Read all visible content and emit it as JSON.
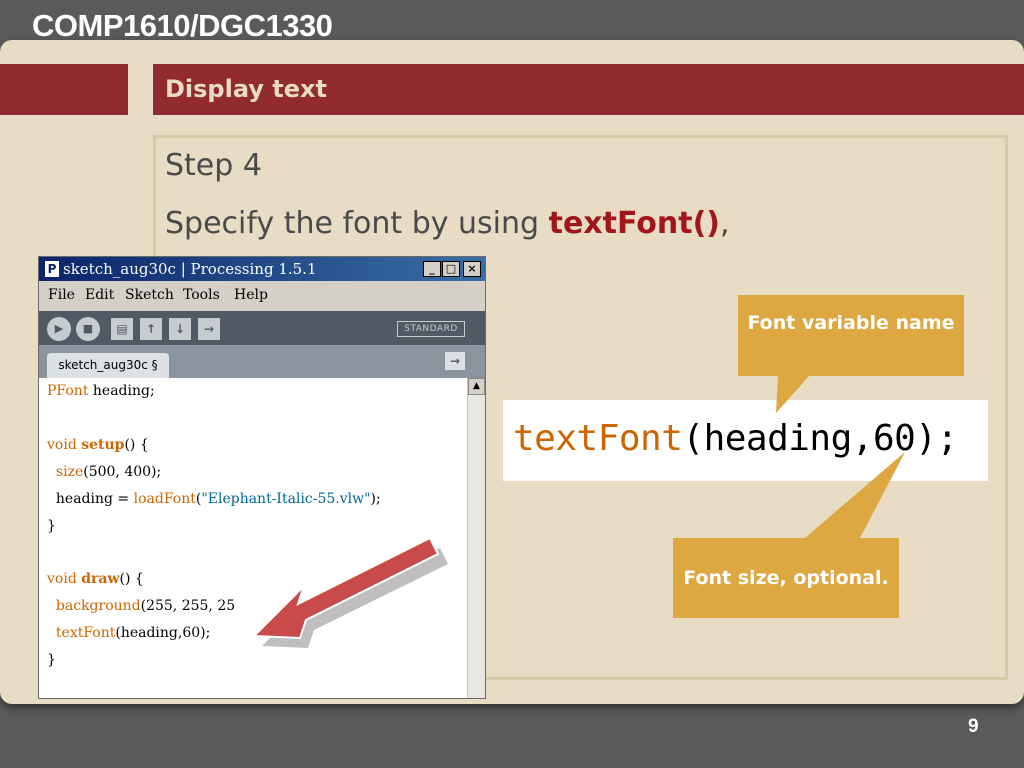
{
  "header": {
    "course": "COMP1610/DGC1330",
    "title": "Display text"
  },
  "content": {
    "step": "Step 4",
    "description_prefix": "Specify the font by using ",
    "description_keyword": "textFont()",
    "description_suffix": ","
  },
  "window": {
    "icon": "P",
    "title": "sketch_aug30c | Processing 1.5.1",
    "controls": {
      "minimize": "_",
      "maximize": "□",
      "close": "×"
    },
    "menu": [
      "File",
      "Edit",
      "Sketch",
      "Tools",
      "Help"
    ],
    "toolbar": {
      "icons": [
        "run-icon",
        "stop-icon",
        "new-icon",
        "open-icon",
        "save-icon",
        "export-icon"
      ],
      "mode": "STANDARD"
    },
    "tab_label": "sketch_aug30c §",
    "code": {
      "l1_type": "PFont",
      "l1_rest": " heading;",
      "l3_kw": "void",
      "l3_fn": "setup",
      "l3_rest": "() {",
      "l4_api": "size",
      "l4_rest": "(500, 400);",
      "l5_pre": "  heading = ",
      "l5_api": "loadFont",
      "l5_open": "(",
      "l5_str": "\"Elephant-Italic-55.vlw\"",
      "l5_close": ");",
      "l6": "}",
      "l8_kw": "void",
      "l8_fn": "draw",
      "l8_rest": "() {",
      "l9_api": "background",
      "l9_rest": "(255, 255, 25",
      "l10_api": "textFont",
      "l10_rest": "(heading,60);",
      "l11": "}"
    }
  },
  "snippet": {
    "api": "textFont",
    "args": "(heading,60);"
  },
  "callouts": {
    "font_variable": "Font variable name",
    "font_size": "Font size, optional."
  },
  "page_number": "9",
  "colors": {
    "background": "#5a5a5a",
    "slide": "#e8dcc4",
    "title_band": "#912b2f",
    "keyword": "#a0161b",
    "callout": "#dda741",
    "arrow": "#c84a4a",
    "code_api": "#cc6600",
    "code_string": "#006699"
  }
}
